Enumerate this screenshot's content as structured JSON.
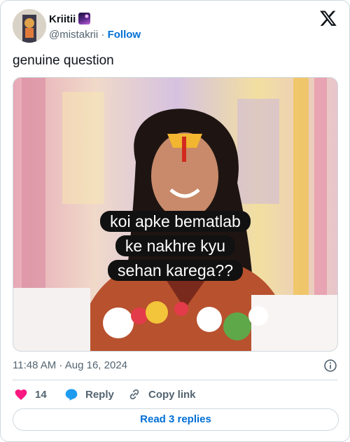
{
  "author": {
    "display_name": "Kriitii",
    "handle": "@mistakrii",
    "separator": "·",
    "follow_label": "Follow",
    "name_emoji": "milky-way-emoji"
  },
  "tweet": {
    "text": "genuine question",
    "image_caption": [
      "koi apke bematlab",
      "ke nakhre kyu",
      "sehan karega??"
    ],
    "timestamp": "11:48 AM · Aug 16, 2024"
  },
  "actions": {
    "like_count": "14",
    "reply_label": "Reply",
    "copy_link_label": "Copy link"
  },
  "read_replies_label": "Read 3 replies",
  "colors": {
    "link": "#006fd6",
    "like": "#f91880",
    "reply": "#1d9bf0",
    "muted": "#536471",
    "border": "#cfd9de"
  },
  "icons": [
    "x-logo-icon",
    "info-icon",
    "heart-icon",
    "reply-bubble-icon",
    "link-icon"
  ]
}
